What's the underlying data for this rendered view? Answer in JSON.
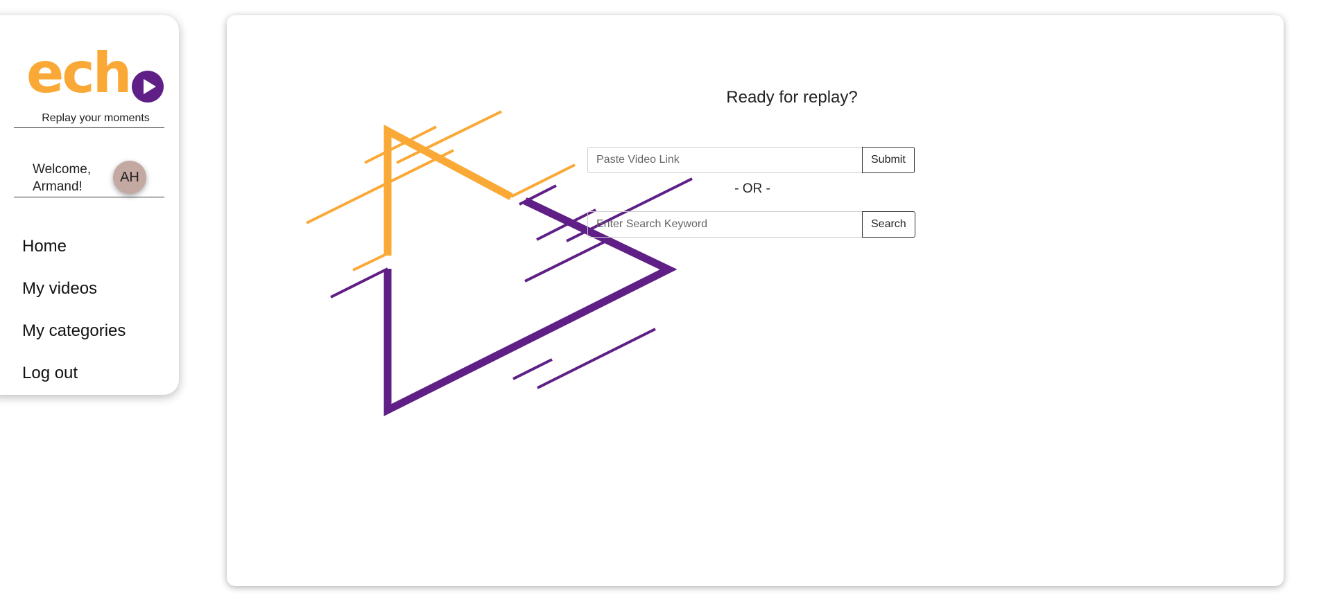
{
  "brand": {
    "logo_text_1": "ech",
    "tagline": "Replay your moments",
    "colors": {
      "orange": "#fba936",
      "purple": "#5f1f86"
    }
  },
  "user": {
    "welcome": "Welcome, Armand!",
    "initials": "AH"
  },
  "sidebar": {
    "items": [
      {
        "label": "Home"
      },
      {
        "label": "My videos"
      },
      {
        "label": "My categories"
      },
      {
        "label": "Log out"
      }
    ]
  },
  "main": {
    "headline": "Ready for replay?",
    "link_form": {
      "placeholder": "Paste Video Link",
      "value": "",
      "submit_label": "Submit"
    },
    "or_text": "- OR -",
    "search_form": {
      "placeholder": "Enter Search Keyword",
      "value": "",
      "search_label": "Search"
    }
  }
}
